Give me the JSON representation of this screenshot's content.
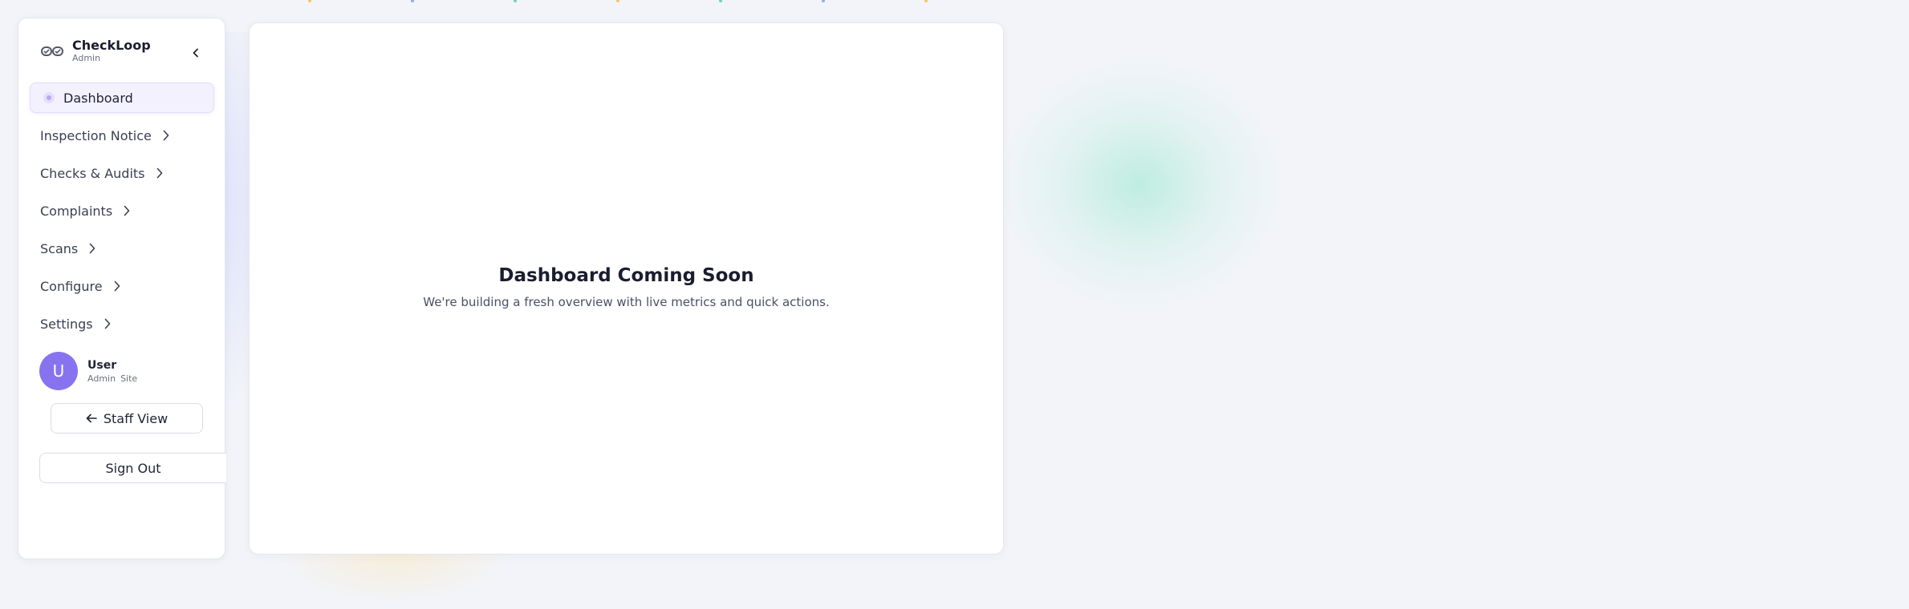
{
  "brand": {
    "name": "CheckLoop",
    "role": "Admin",
    "logo_icon": "checkloop-logo-icon"
  },
  "sidebar": {
    "collapse_icon": "chevron-left-icon",
    "active_item": "Dashboard",
    "items": [
      {
        "label": "Dashboard",
        "active": true
      },
      {
        "label": "Inspection Notice",
        "has_submenu": true
      },
      {
        "label": "Checks & Audits",
        "has_submenu": true
      },
      {
        "label": "Complaints",
        "has_submenu": true
      },
      {
        "label": "Scans",
        "has_submenu": true
      },
      {
        "label": "Configure",
        "has_submenu": true
      },
      {
        "label": "Settings",
        "has_submenu": true
      }
    ]
  },
  "user": {
    "initial": "U",
    "name": "User",
    "role": "Admin",
    "site": "Site"
  },
  "buttons": {
    "staff_view": "Staff View",
    "sign_out": "Sign Out"
  },
  "main": {
    "title": "Dashboard Coming Soon",
    "subtitle": "We're building a fresh overview with live metrics and quick actions."
  },
  "colors": {
    "accent": "#8773f0",
    "active_bg": "#f4f1fe",
    "background": "#f2f4f9",
    "glow": "#80e4c4"
  }
}
